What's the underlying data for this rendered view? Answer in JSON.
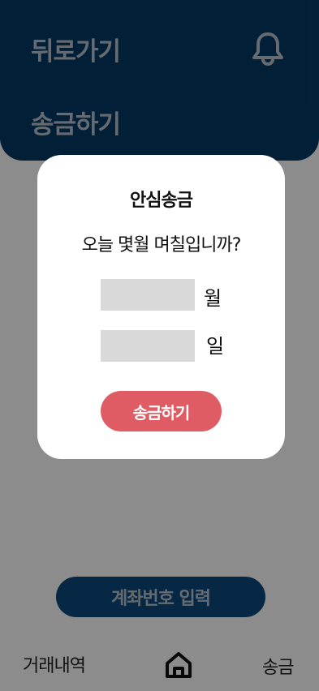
{
  "header": {
    "back_label": "뒤로가기",
    "notification_icon": "bell-icon",
    "page_title": "송금하기"
  },
  "main": {
    "account_button_label": "계좌번호 입력"
  },
  "tabbar": {
    "history_label": "거래내역",
    "home_icon": "home-icon",
    "send_label": "송금"
  },
  "modal": {
    "title": "안심송금",
    "question": "오늘 몇월 며칠입니까?",
    "month_value": "",
    "month_unit": "월",
    "day_value": "",
    "day_unit": "일",
    "submit_label": "송금하기"
  },
  "colors": {
    "header_bg": "#033a63",
    "overlay": "rgba(0,0,0,0.45)",
    "primary_button": "#e05c64",
    "account_button": "#0b4a7c"
  }
}
